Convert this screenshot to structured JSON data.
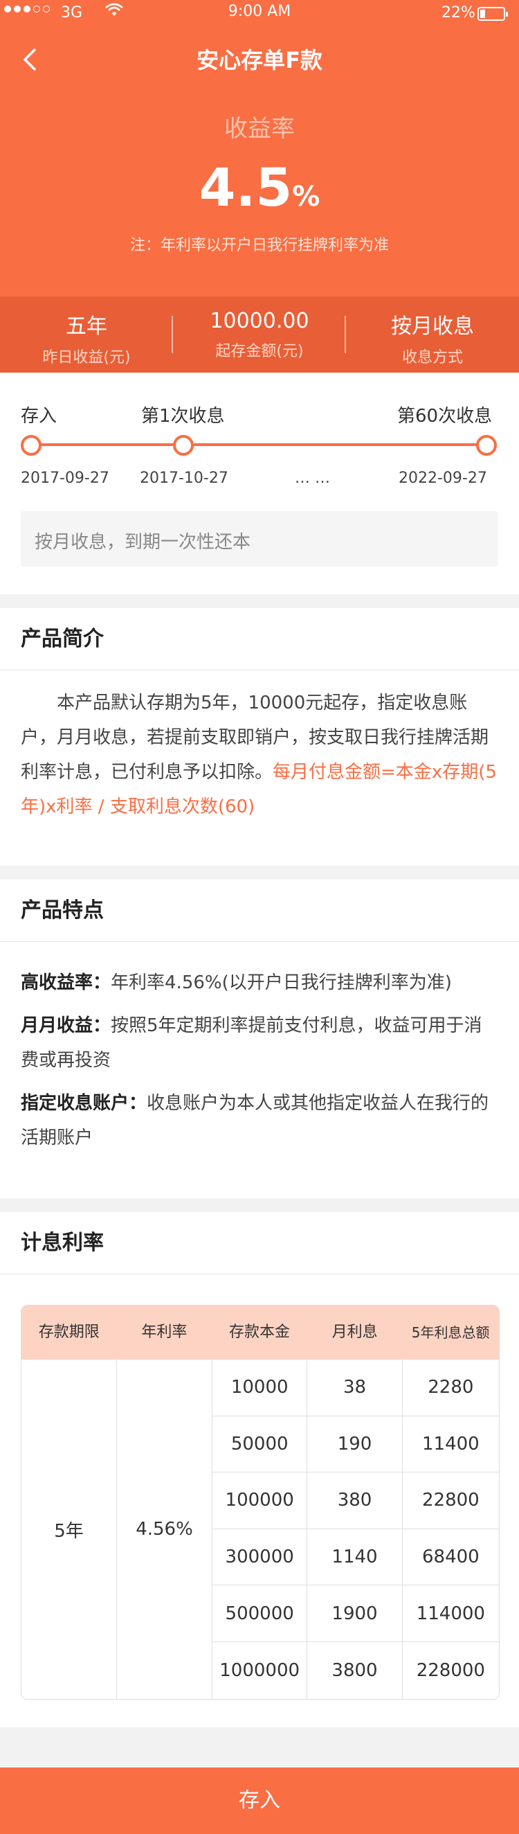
{
  "status_bar": {
    "carrier": "3G",
    "time": "9:00 AM",
    "battery": "22%",
    "battery_level": 0.22
  },
  "nav": {
    "title": "安心存单F款"
  },
  "hero": {
    "rate_label": "收益率",
    "rate_number": "4.5",
    "rate_unit": "%",
    "note": "注：年利率以开户日我行挂牌利率为准"
  },
  "summary": [
    {
      "value": "五年",
      "label": "昨日收益(元)"
    },
    {
      "value": "10000.00",
      "label": "起存金额(元)"
    },
    {
      "value": "按月收息",
      "label": "收息方式"
    }
  ],
  "timeline": {
    "labels": [
      "存入",
      "第1次收息",
      "第60次收息"
    ],
    "dates": [
      "2017-09-27",
      "2017-10-27",
      "… …",
      "2022-09-27"
    ],
    "note": "按月收息，到期一次性还本"
  },
  "intro": {
    "title": "产品简介",
    "text": "本产品默认存期为5年，10000元起存，指定收息账户，月月收息，若提前支取即销户，按支取日我行挂牌活期利率计息，已付利息予以扣除。",
    "highlight": "每月付息金额=本金x存期(5年)x利率 / 支取利息次数(60)"
  },
  "features": {
    "title": "产品特点",
    "items": [
      {
        "name": "高收益率：",
        "desc": "年利率4.56%(以开户日我行挂牌利率为准)"
      },
      {
        "name": "月月收益：",
        "desc": "按照5年定期利率提前支付利息，收益可用于消费或再投资"
      },
      {
        "name": "指定收息账户：",
        "desc": "收息账户为本人或其他指定收益人在我行的活期账户"
      }
    ]
  },
  "rates": {
    "title": "计息利率",
    "headers": [
      "存款期限",
      "年利率",
      "存款本金",
      "月利息",
      "5年利息总额"
    ],
    "term": "5年",
    "annual_rate": "4.56%",
    "rows": [
      [
        "10000",
        "38",
        "2280"
      ],
      [
        "50000",
        "190",
        "11400"
      ],
      [
        "100000",
        "380",
        "22800"
      ],
      [
        "300000",
        "1140",
        "68400"
      ],
      [
        "500000",
        "1900",
        "114000"
      ],
      [
        "1000000",
        "3800",
        "228000"
      ]
    ]
  },
  "cta": {
    "label": "存入"
  },
  "colors": {
    "accent": "#f96e43",
    "summary_bg": "#e85e36",
    "table_header": "#fdd3c3"
  }
}
